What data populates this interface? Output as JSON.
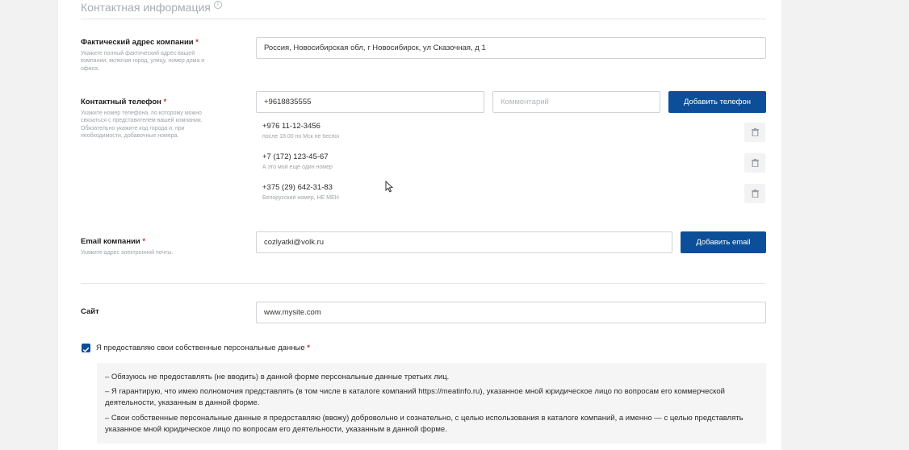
{
  "section": {
    "title": "Контактная информация"
  },
  "address": {
    "label": "Фактический адрес компании",
    "required_mark": "*",
    "hint": "Укажите полный фактический адрес вашей компании, включая город, улицу, номер дома и офиса.",
    "value": "Россия, Новосибирская обл, г Новосибирск, ул Сказочная, д 1"
  },
  "phone": {
    "label": "Контактный телефон",
    "required_mark": "*",
    "hint": "Укажите номер телефона, по которому можно связаться с представителем вашей компании. Обязательно укажите код города и, при необходимости, добавочные номера.",
    "value": "+9618835555",
    "comment_placeholder": "Комментарий",
    "add_button": "Добавить телефон",
    "list": [
      {
        "number": "+976 11-12-3456",
        "comment": "после 18.00 по Мск не беспокоить"
      },
      {
        "number": "+7 (172) 123-45-67",
        "comment": "А это мой еще один номер"
      },
      {
        "number": "+375 (29) 642-31-83",
        "comment": "Белорусский номер, НЕ МЕНЯТЬ"
      }
    ]
  },
  "email": {
    "label": "Email компании",
    "required_mark": "*",
    "hint": "Укажите адрес электронной почты.",
    "value": "cozlyatki@volk.ru",
    "add_button": "Добавить email"
  },
  "site": {
    "label": "Сайт",
    "value": "www.mysite.com"
  },
  "consent": {
    "checkbox_label": "Я предоставляю свои собственные персональные данные",
    "required_mark": "*",
    "checked": true,
    "lines": [
      "– Обязуюсь не предоставлять (не вводить) в данной форме персональные данные третьих лиц.",
      "– Я гарантирую, что имею полномочия представлять (в том числе в каталоге компаний https://meatinfo.ru), указанное мной юридическое лицо по вопросам его коммерческой",
      "деятельности, указанным в данной форме.",
      "– Свои собственные персональные данные я предоставляю (ввожу) добровольно и сознательно, с целью использования в каталоге компаний, а именно — с целью представлять",
      "указанное мной юридическое лицо по вопросам его деятельности, указанным в данной форме."
    ]
  },
  "colors": {
    "primary": "#0c4f98",
    "required": "#c0392b"
  },
  "icons": {
    "info": "info-icon",
    "trash": "trash-icon",
    "check": "checkmark-icon",
    "cursor": "mouse-cursor-icon"
  }
}
